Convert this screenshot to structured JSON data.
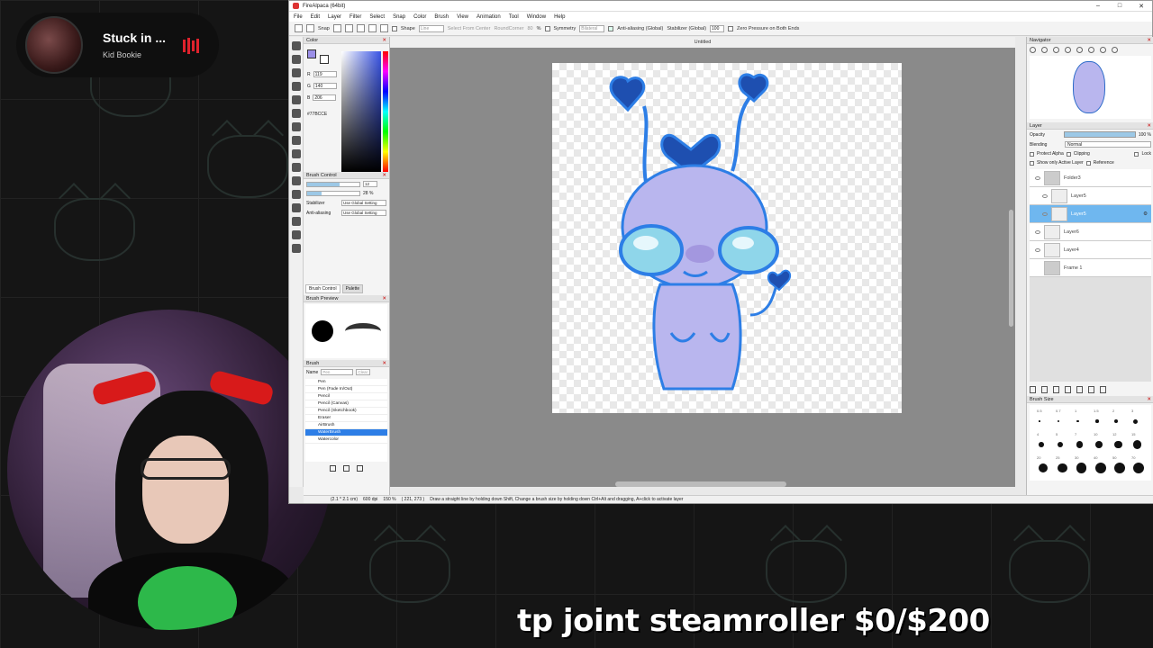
{
  "music": {
    "song": "Stuck in ...",
    "artist": "Kid Bookie"
  },
  "app": {
    "title": "FireAlpaca (64bit)",
    "window_controls": [
      "–",
      "□",
      "✕"
    ],
    "menu": [
      "File",
      "Edit",
      "Layer",
      "Filter",
      "Select",
      "Snap",
      "Color",
      "Brush",
      "View",
      "Animation",
      "Tool",
      "Window",
      "Help"
    ],
    "toolbar": {
      "snap": "Snap",
      "shape_label": "Shape",
      "shape_value": "Line",
      "select_from_center": "Select From Center",
      "round_corner": "RoundCorner",
      "round_value": "80",
      "percent": "%",
      "symmetry": "Symmetry",
      "symmetry_value": "Bilateral",
      "anti_aliasing": "Anti-aliasing (Global)",
      "stabilizer": "Stabilizer (Global)",
      "stabilizer_value": "100",
      "zero_pressure": "Zero Pressure on Both Ends"
    },
    "document_tab": "Untitled",
    "color_panel": {
      "title": "Color",
      "r_label": "R",
      "r": "119",
      "g_label": "G",
      "g": "140",
      "b_label": "B",
      "b": "206",
      "hex": "#77BCCE",
      "fg_color": "#9b8fe8"
    },
    "brush_control": {
      "title": "Brush Control",
      "size_value": "12",
      "size_fill": 0.62,
      "opacity_value": "28 %",
      "opacity_fill": 0.28,
      "stabilizer_label": "Stabilizer",
      "stabilizer_value": "Use Global Setting",
      "antialias_label": "Anti-aliasing",
      "antialias_value": "Use Global Setting",
      "tab_brush_control": "Brush Control",
      "tab_palette": "Palette"
    },
    "brush_preview": {
      "title": "Brush Preview"
    },
    "brush_panel": {
      "title": "Brush",
      "name_label": "Name",
      "name_value": "Pen",
      "clear_label": "Clear",
      "items": [
        "Pen",
        "Pen (Fade In/Out)",
        "Pencil",
        "Pencil (Canvas)",
        "Pencil (Sketchbook)",
        "Eraser",
        "AirBrush",
        "WaterBrush",
        "Watercolor"
      ],
      "selected_index": 7
    },
    "status_bar": {
      "size": "(2.1 * 2.1 cm)",
      "dpi": "600 dpi",
      "zoom": "150 %",
      "coords": "( 221, 273 )",
      "hint": "Draw a straight line by holding down Shift, Change a brush size by holding down Ctrl+Alt and dragging, A+click to activate layer"
    },
    "navigator": {
      "title": "Navigator"
    },
    "layer_panel": {
      "title": "Layer",
      "opacity_label": "Opacity",
      "opacity_value": "100 %",
      "blending_label": "Blending",
      "blending_value": "Normal",
      "protect_alpha": "Protect Alpha",
      "clipping": "Clipping",
      "lock": "Lock",
      "show_only_active": "Show only Active Layer",
      "reference": "Reference",
      "layers": [
        {
          "name": "Folder3",
          "selected": false
        },
        {
          "name": "Layer5",
          "selected": false
        },
        {
          "name": "Layer5",
          "selected": true
        },
        {
          "name": "Layer6",
          "selected": false
        },
        {
          "name": "Layer4",
          "selected": false
        },
        {
          "name": "Frame 1",
          "selected": false
        }
      ]
    },
    "brush_size": {
      "title": "Brush Size",
      "labels": [
        "0.5",
        "0.7",
        "1",
        "1.5",
        "2",
        "3",
        "4",
        "5",
        "7",
        "10",
        "12",
        "15",
        "20",
        "25",
        "30",
        "40",
        "50",
        "70"
      ]
    }
  },
  "overlay": {
    "subgoal": "tp joint steamroller $0/$200"
  }
}
